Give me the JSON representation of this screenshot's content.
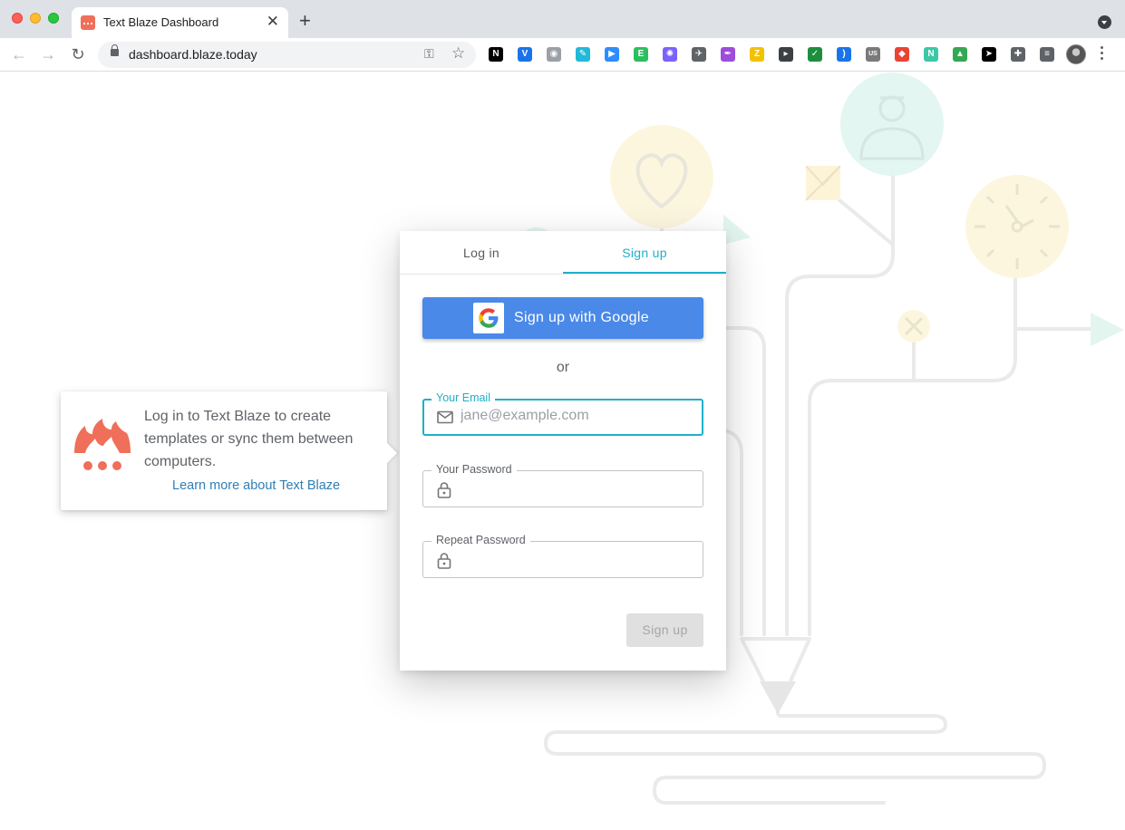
{
  "browser": {
    "tab_title": "Text Blaze Dashboard",
    "tab_close": "✕",
    "new_tab": "+",
    "url": "dashboard.blaze.today",
    "back": "←",
    "forward": "→",
    "reload": "↻",
    "key": "⚿",
    "star": "☆",
    "extensions": [
      {
        "name": "notion-extension-icon",
        "glyph": "N",
        "bg": "#000000"
      },
      {
        "name": "vimeo-extension-icon",
        "glyph": "V",
        "bg": "#1a73e8"
      },
      {
        "name": "camera-extension-icon",
        "glyph": "◉",
        "bg": "#9aa0a6"
      },
      {
        "name": "pen-extension-icon",
        "glyph": "✎",
        "bg": "#22b8d8"
      },
      {
        "name": "zoom-extension-icon",
        "glyph": "▶",
        "bg": "#2d8cff"
      },
      {
        "name": "evernote-extension-icon",
        "glyph": "E",
        "bg": "#2dbe60"
      },
      {
        "name": "flower-extension-icon",
        "glyph": "✺",
        "bg": "#7b61ff"
      },
      {
        "name": "bird-extension-icon",
        "glyph": "✈",
        "bg": "#5f6368"
      },
      {
        "name": "feather-extension-icon",
        "glyph": "✒",
        "bg": "#9c4ddc"
      },
      {
        "name": "z-extension-icon",
        "glyph": "Z",
        "bg": "#f2c200"
      },
      {
        "name": "media-extension-icon",
        "glyph": "▸",
        "bg": "#3c4043"
      },
      {
        "name": "check-extension-icon",
        "glyph": "✓",
        "bg": "#1e8e3e"
      },
      {
        "name": "signal-extension-icon",
        "glyph": ")",
        "bg": "#1a73e8"
      },
      {
        "name": "us-extension-icon",
        "glyph": "US",
        "bg": "#7a7a7a"
      },
      {
        "name": "shield-extension-icon",
        "glyph": "◆",
        "bg": "#ea4335"
      },
      {
        "name": "n-extension-icon",
        "glyph": "N",
        "bg": "#3cc8a6"
      },
      {
        "name": "drive-extension-icon",
        "glyph": "▲",
        "bg": "#34a853"
      },
      {
        "name": "send-extension-icon",
        "glyph": "➤",
        "bg": "#000000"
      },
      {
        "name": "puzzle-extension-icon",
        "glyph": "✚",
        "bg": "#5f6368"
      },
      {
        "name": "media-list-extension-icon",
        "glyph": "≡",
        "bg": "#5f6368"
      }
    ]
  },
  "auth": {
    "tab_login": "Log in",
    "tab_signup": "Sign up",
    "google_button": "Sign up with Google",
    "or_text": "or",
    "email_label": "Your Email",
    "email_placeholder": "jane@example.com",
    "password_label": "Your Password",
    "repeat_password_label": "Repeat Password",
    "submit_label": "Sign up"
  },
  "info": {
    "text": "Log in to Text Blaze to create templates or sync them between computers.",
    "link": "Learn more about Text Blaze"
  },
  "colors": {
    "accent": "#1eb0c8",
    "google_blue": "#4a89e8",
    "brand_orange": "#ef6f5a",
    "link": "#2f7fb5"
  }
}
